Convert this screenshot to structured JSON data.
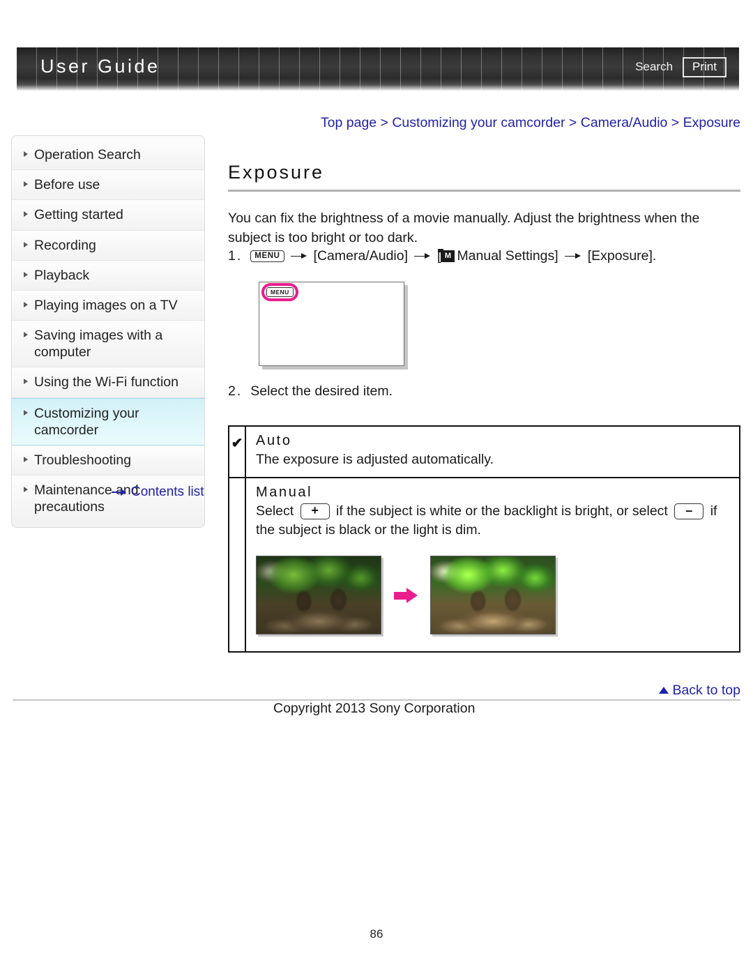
{
  "header": {
    "logo": "User Guide",
    "search_label": "Search",
    "print_label": "Print"
  },
  "sidebar": {
    "items": [
      {
        "label": "Operation Search",
        "active": false
      },
      {
        "label": "Before use",
        "active": false
      },
      {
        "label": "Getting started",
        "active": false
      },
      {
        "label": "Recording",
        "active": false
      },
      {
        "label": "Playback",
        "active": false
      },
      {
        "label": "Playing images on a TV",
        "active": false
      },
      {
        "label": "Saving images with a computer",
        "active": false
      },
      {
        "label": "Using the Wi-Fi function",
        "active": false
      },
      {
        "label": "Customizing your camcorder",
        "active": true
      },
      {
        "label": "Troubleshooting",
        "active": false
      },
      {
        "label": "Maintenance and precautions",
        "active": false
      }
    ],
    "contents_list_label": "Contents list"
  },
  "main": {
    "breadcrumb": "Top page > Customizing your camcorder > Camera/Audio > Exposure",
    "title": "Exposure",
    "intro": "You can fix the brightness of a movie manually. Adjust the brightness when the subject is too bright or too dark.",
    "step1": {
      "number": "1.",
      "menu_icon_label": "MENU",
      "part_camera_audio": "[Camera/Audio]",
      "part_manual_open": "[",
      "manual_icon_label": "M",
      "part_manual_settings": "Manual Settings]",
      "part_exposure": "[Exposure]."
    },
    "illustration": {
      "menu_button_label": "MENU",
      "highlight_color": "#ea1d8d"
    },
    "step2": {
      "number": "2.",
      "text": "Select the desired item."
    },
    "options": [
      {
        "checked": true,
        "check_glyph": "✔",
        "label": "Auto",
        "description": "The exposure is adjusted automatically."
      },
      {
        "checked": false,
        "check_glyph": "",
        "label": "Manual",
        "desc_before_plus": "Select",
        "plus_label": "+",
        "desc_middle": "if the subject is white or the backlight is bright, or select",
        "minus_label": "–",
        "desc_after_minus": "if the subject is black or the light is dim."
      }
    ]
  },
  "footer": {
    "back_to_top": "Back to top",
    "copyright": "Copyright 2013 Sony Corporation",
    "page_number": "86"
  }
}
